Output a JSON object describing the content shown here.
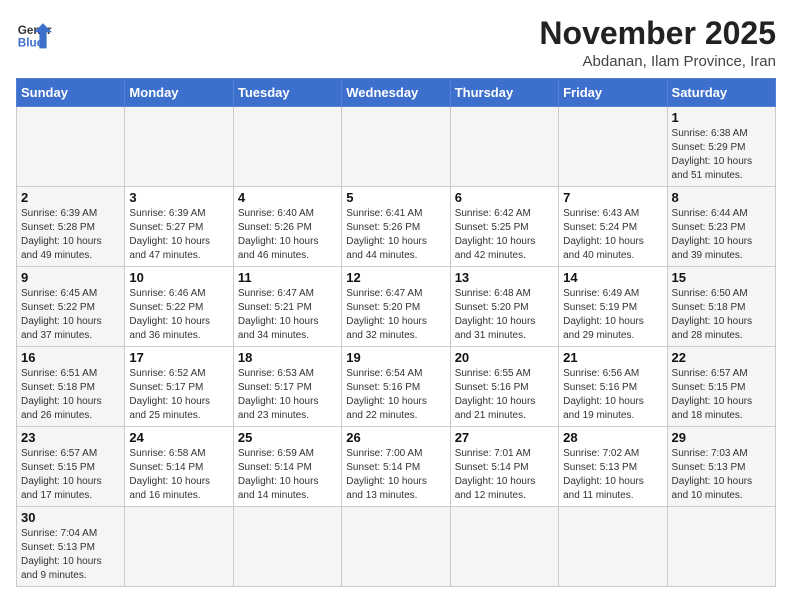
{
  "logo": {
    "line1": "General",
    "line2": "Blue"
  },
  "title": "November 2025",
  "subtitle": "Abdanan, Ilam Province, Iran",
  "weekdays": [
    "Sunday",
    "Monday",
    "Tuesday",
    "Wednesday",
    "Thursday",
    "Friday",
    "Saturday"
  ],
  "weeks": [
    [
      {
        "day": "",
        "info": ""
      },
      {
        "day": "",
        "info": ""
      },
      {
        "day": "",
        "info": ""
      },
      {
        "day": "",
        "info": ""
      },
      {
        "day": "",
        "info": ""
      },
      {
        "day": "",
        "info": ""
      },
      {
        "day": "1",
        "info": "Sunrise: 6:38 AM\nSunset: 5:29 PM\nDaylight: 10 hours and 51 minutes."
      }
    ],
    [
      {
        "day": "2",
        "info": "Sunrise: 6:39 AM\nSunset: 5:28 PM\nDaylight: 10 hours and 49 minutes."
      },
      {
        "day": "3",
        "info": "Sunrise: 6:39 AM\nSunset: 5:27 PM\nDaylight: 10 hours and 47 minutes."
      },
      {
        "day": "4",
        "info": "Sunrise: 6:40 AM\nSunset: 5:26 PM\nDaylight: 10 hours and 46 minutes."
      },
      {
        "day": "5",
        "info": "Sunrise: 6:41 AM\nSunset: 5:26 PM\nDaylight: 10 hours and 44 minutes."
      },
      {
        "day": "6",
        "info": "Sunrise: 6:42 AM\nSunset: 5:25 PM\nDaylight: 10 hours and 42 minutes."
      },
      {
        "day": "7",
        "info": "Sunrise: 6:43 AM\nSunset: 5:24 PM\nDaylight: 10 hours and 40 minutes."
      },
      {
        "day": "8",
        "info": "Sunrise: 6:44 AM\nSunset: 5:23 PM\nDaylight: 10 hours and 39 minutes."
      }
    ],
    [
      {
        "day": "9",
        "info": "Sunrise: 6:45 AM\nSunset: 5:22 PM\nDaylight: 10 hours and 37 minutes."
      },
      {
        "day": "10",
        "info": "Sunrise: 6:46 AM\nSunset: 5:22 PM\nDaylight: 10 hours and 36 minutes."
      },
      {
        "day": "11",
        "info": "Sunrise: 6:47 AM\nSunset: 5:21 PM\nDaylight: 10 hours and 34 minutes."
      },
      {
        "day": "12",
        "info": "Sunrise: 6:47 AM\nSunset: 5:20 PM\nDaylight: 10 hours and 32 minutes."
      },
      {
        "day": "13",
        "info": "Sunrise: 6:48 AM\nSunset: 5:20 PM\nDaylight: 10 hours and 31 minutes."
      },
      {
        "day": "14",
        "info": "Sunrise: 6:49 AM\nSunset: 5:19 PM\nDaylight: 10 hours and 29 minutes."
      },
      {
        "day": "15",
        "info": "Sunrise: 6:50 AM\nSunset: 5:18 PM\nDaylight: 10 hours and 28 minutes."
      }
    ],
    [
      {
        "day": "16",
        "info": "Sunrise: 6:51 AM\nSunset: 5:18 PM\nDaylight: 10 hours and 26 minutes."
      },
      {
        "day": "17",
        "info": "Sunrise: 6:52 AM\nSunset: 5:17 PM\nDaylight: 10 hours and 25 minutes."
      },
      {
        "day": "18",
        "info": "Sunrise: 6:53 AM\nSunset: 5:17 PM\nDaylight: 10 hours and 23 minutes."
      },
      {
        "day": "19",
        "info": "Sunrise: 6:54 AM\nSunset: 5:16 PM\nDaylight: 10 hours and 22 minutes."
      },
      {
        "day": "20",
        "info": "Sunrise: 6:55 AM\nSunset: 5:16 PM\nDaylight: 10 hours and 21 minutes."
      },
      {
        "day": "21",
        "info": "Sunrise: 6:56 AM\nSunset: 5:16 PM\nDaylight: 10 hours and 19 minutes."
      },
      {
        "day": "22",
        "info": "Sunrise: 6:57 AM\nSunset: 5:15 PM\nDaylight: 10 hours and 18 minutes."
      }
    ],
    [
      {
        "day": "23",
        "info": "Sunrise: 6:57 AM\nSunset: 5:15 PM\nDaylight: 10 hours and 17 minutes."
      },
      {
        "day": "24",
        "info": "Sunrise: 6:58 AM\nSunset: 5:14 PM\nDaylight: 10 hours and 16 minutes."
      },
      {
        "day": "25",
        "info": "Sunrise: 6:59 AM\nSunset: 5:14 PM\nDaylight: 10 hours and 14 minutes."
      },
      {
        "day": "26",
        "info": "Sunrise: 7:00 AM\nSunset: 5:14 PM\nDaylight: 10 hours and 13 minutes."
      },
      {
        "day": "27",
        "info": "Sunrise: 7:01 AM\nSunset: 5:14 PM\nDaylight: 10 hours and 12 minutes."
      },
      {
        "day": "28",
        "info": "Sunrise: 7:02 AM\nSunset: 5:13 PM\nDaylight: 10 hours and 11 minutes."
      },
      {
        "day": "29",
        "info": "Sunrise: 7:03 AM\nSunset: 5:13 PM\nDaylight: 10 hours and 10 minutes."
      }
    ],
    [
      {
        "day": "30",
        "info": "Sunrise: 7:04 AM\nSunset: 5:13 PM\nDaylight: 10 hours and 9 minutes."
      },
      {
        "day": "",
        "info": ""
      },
      {
        "day": "",
        "info": ""
      },
      {
        "day": "",
        "info": ""
      },
      {
        "day": "",
        "info": ""
      },
      {
        "day": "",
        "info": ""
      },
      {
        "day": "",
        "info": ""
      }
    ]
  ]
}
